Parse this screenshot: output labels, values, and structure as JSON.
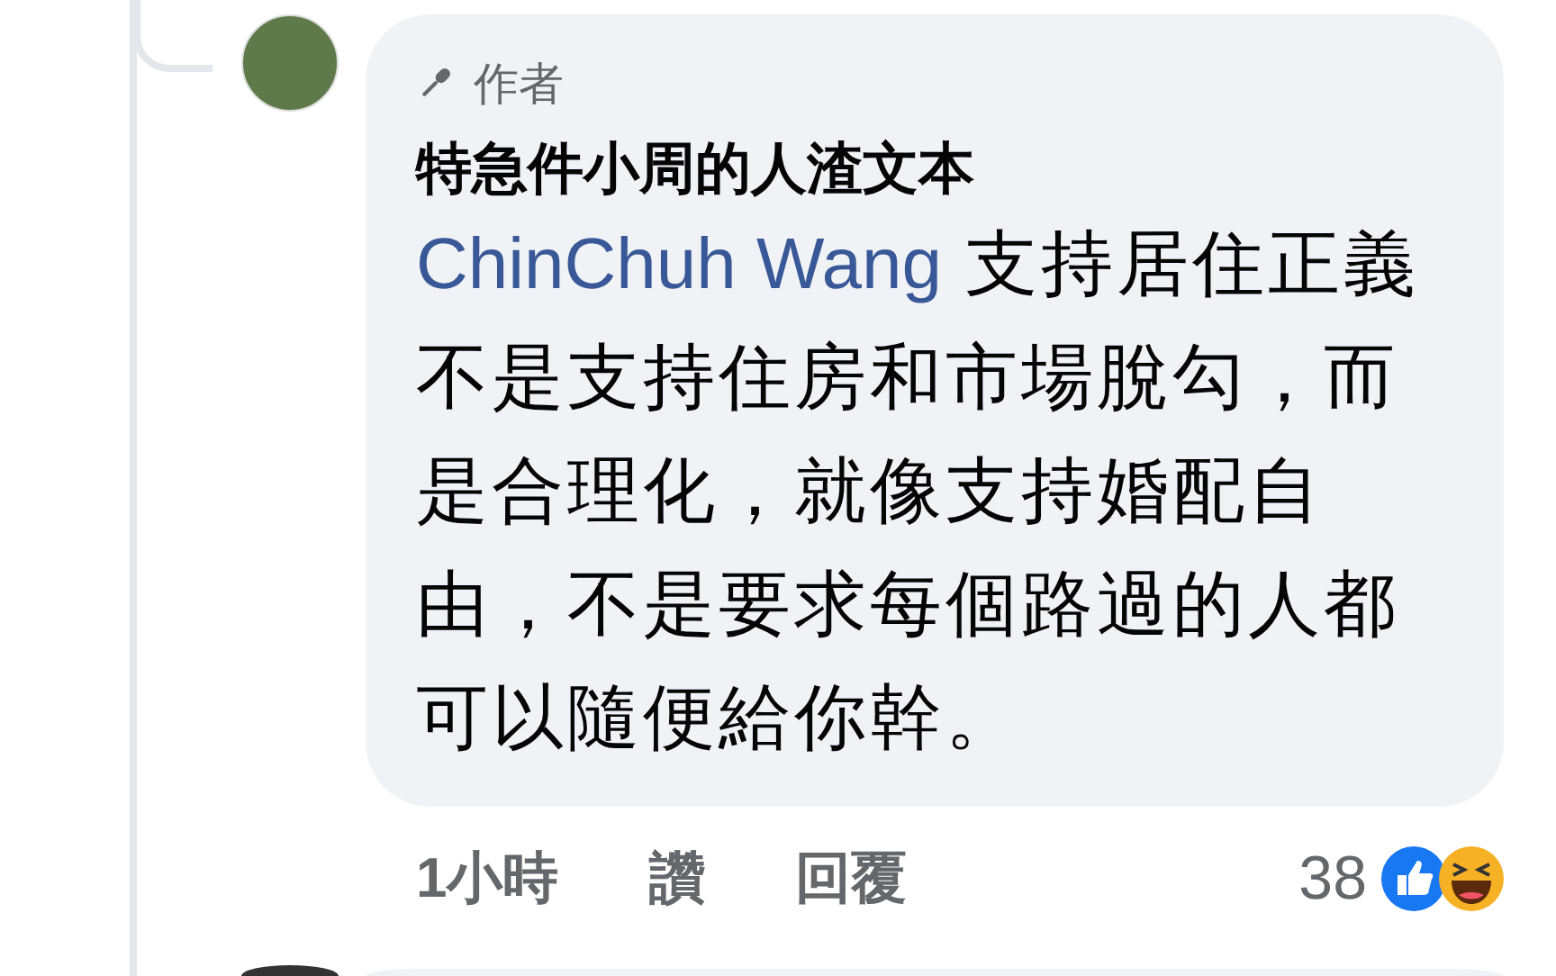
{
  "comment": {
    "badge": "作者",
    "author": "特急件小周的人渣文本",
    "mention": "ChinChuh Wang",
    "text": "支持居住正義不是支持住房和市場脫勾，而是合理化，就像支持婚配自由，不是要求每個路過的人都可以隨便給你幹。",
    "time": "1小時",
    "actions": [
      {
        "label": "讚"
      },
      {
        "label": "回覆"
      }
    ],
    "reaction_count": "38"
  }
}
